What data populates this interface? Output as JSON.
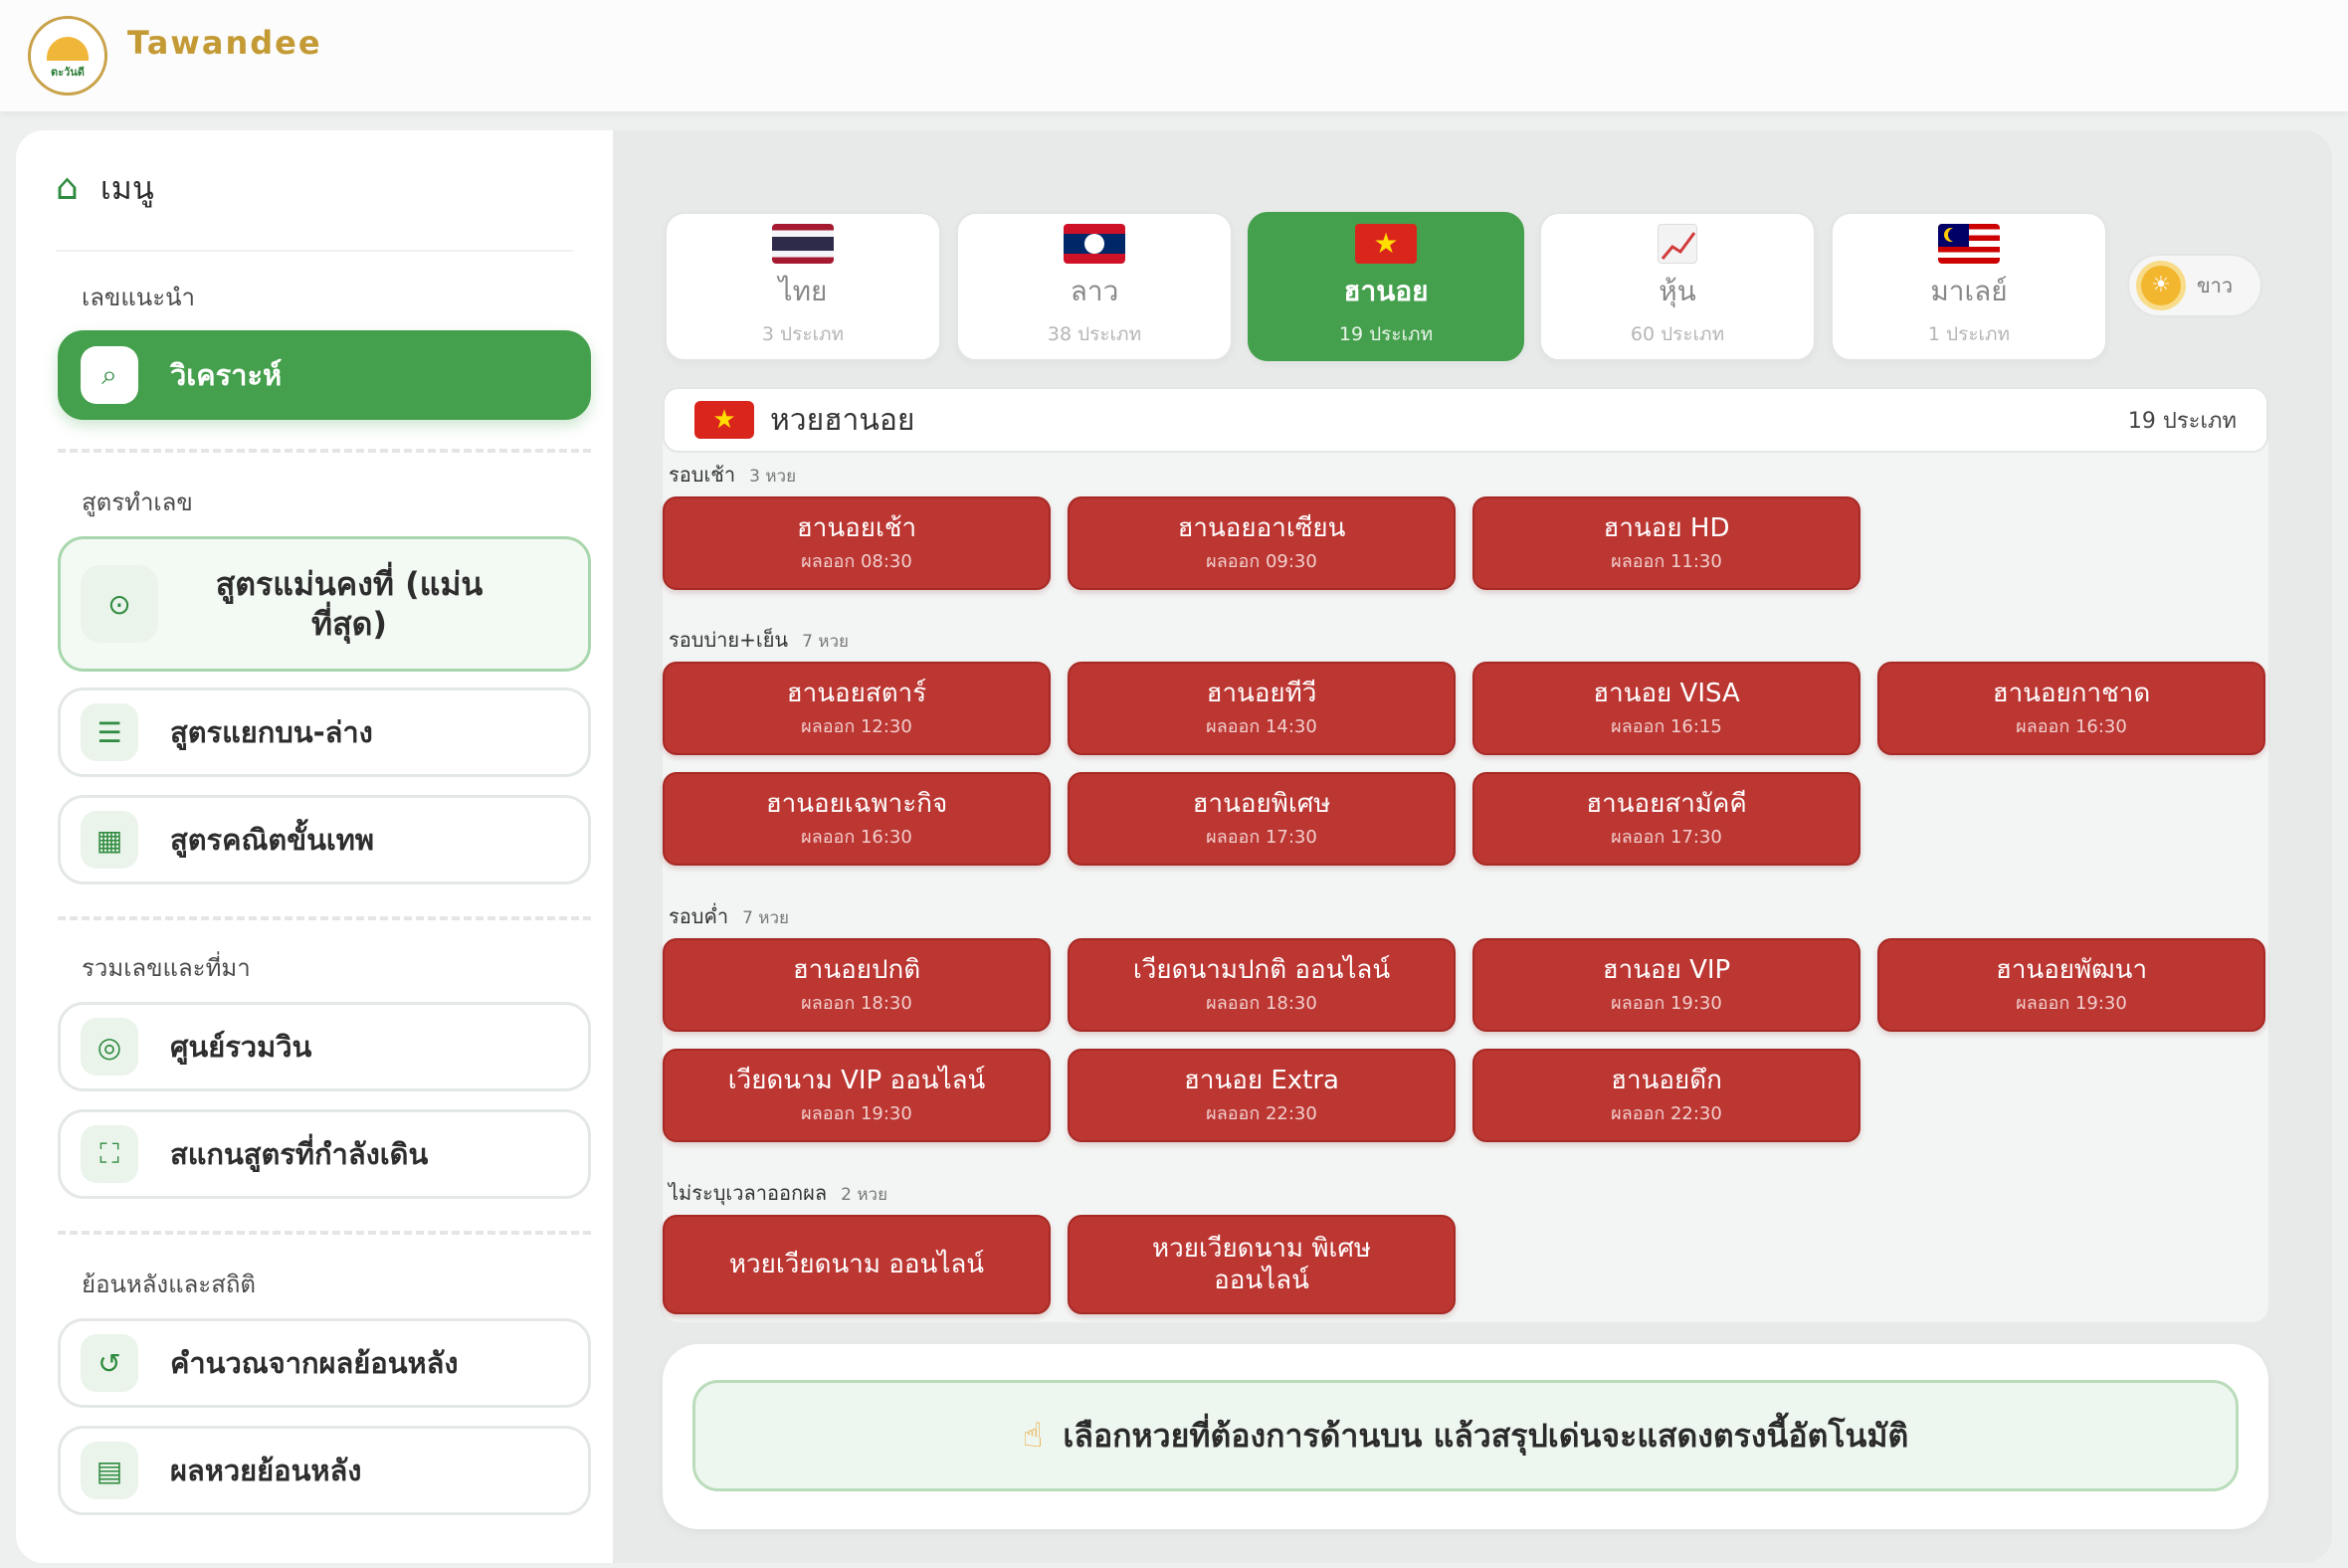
{
  "header": {
    "brand": "Tawandee",
    "logo_text": "ตะวันดี"
  },
  "sidebar": {
    "menu_title": "เมนู",
    "sections": [
      {
        "label": "เลขแนะนำ",
        "items": [
          {
            "label": "วิเคราะห์",
            "icon": "search-icon",
            "active": true
          }
        ]
      },
      {
        "label": "สูตรทำเลข",
        "items": [
          {
            "label": "สูตรแม่นคงที่ (แม่นที่สุด)",
            "icon": "target-icon",
            "highlight": true
          },
          {
            "label": "สูตรแยกบน-ล่าง",
            "icon": "rows-icon"
          },
          {
            "label": "สูตรคณิตขั้นเทพ",
            "icon": "calculator-icon"
          }
        ]
      },
      {
        "label": "รวมเลขและที่มา",
        "items": [
          {
            "label": "ศูนย์รวมวิน",
            "icon": "bullseye-icon"
          },
          {
            "label": "สแกนสูตรที่กำลังเดิน",
            "icon": "scan-icon"
          }
        ]
      },
      {
        "label": "ย้อนหลังและสถิติ",
        "items": [
          {
            "label": "คำนวณจากผลย้อนหลัง",
            "icon": "history-icon"
          },
          {
            "label": "ผลหวยย้อนหลัง",
            "icon": "calendar-icon"
          }
        ]
      }
    ]
  },
  "tabs": [
    {
      "name": "ไทย",
      "count": "3 ประเภท",
      "flag": "thai-flag-icon"
    },
    {
      "name": "ลาว",
      "count": "38 ประเภท",
      "flag": "laos-flag-icon"
    },
    {
      "name": "ฮานอย",
      "count": "19 ประเภท",
      "flag": "vietnam-flag-icon",
      "active": true
    },
    {
      "name": "หุ้น",
      "count": "60 ประเภท",
      "flag": "chart-icon"
    },
    {
      "name": "มาเลย์",
      "count": "1 ประเภท",
      "flag": "malaysia-flag-icon"
    }
  ],
  "theme_toggle": {
    "label": "ขาว",
    "icon": "sun-icon"
  },
  "panel": {
    "title": "หวยฮานอย",
    "count": "19 ประเภท",
    "groups": [
      {
        "label": "รอบเช้า",
        "count": "3 หวย",
        "items": [
          {
            "name": "ฮานอยเช้า",
            "time": "ผลออก 08:30"
          },
          {
            "name": "ฮานอยอาเซียน",
            "time": "ผลออก 09:30"
          },
          {
            "name": "ฮานอย HD",
            "time": "ผลออก 11:30"
          }
        ]
      },
      {
        "label": "รอบบ่าย+เย็น",
        "count": "7 หวย",
        "items": [
          {
            "name": "ฮานอยสตาร์",
            "time": "ผลออก 12:30"
          },
          {
            "name": "ฮานอยทีวี",
            "time": "ผลออก 14:30"
          },
          {
            "name": "ฮานอย VISA",
            "time": "ผลออก 16:15"
          },
          {
            "name": "ฮานอยกาชาด",
            "time": "ผลออก 16:30"
          },
          {
            "name": "ฮานอยเฉพาะกิจ",
            "time": "ผลออก 16:30"
          },
          {
            "name": "ฮานอยพิเศษ",
            "time": "ผลออก 17:30"
          },
          {
            "name": "ฮานอยสามัคคี",
            "time": "ผลออก 17:30"
          }
        ]
      },
      {
        "label": "รอบค่ำ",
        "count": "7 หวย",
        "items": [
          {
            "name": "ฮานอยปกติ",
            "time": "ผลออก 18:30"
          },
          {
            "name": "เวียดนามปกติ ออนไลน์",
            "time": "ผลออก 18:30"
          },
          {
            "name": "ฮานอย VIP",
            "time": "ผลออก 19:30"
          },
          {
            "name": "ฮานอยพัฒนา",
            "time": "ผลออก 19:30"
          },
          {
            "name": "เวียดนาม VIP ออนไลน์",
            "time": "ผลออก 19:30"
          },
          {
            "name": "ฮานอย Extra",
            "time": "ผลออก 22:30"
          },
          {
            "name": "ฮานอยดึก",
            "time": "ผลออก 22:30"
          }
        ]
      },
      {
        "label": "ไม่ระบุเวลาออกผล",
        "count": "2 หวย",
        "items": [
          {
            "name": "หวยเวียดนาม ออนไลน์",
            "time": ""
          },
          {
            "name": "หวยเวียดนาม พิเศษ ออนไลน์",
            "time": ""
          }
        ]
      }
    ]
  },
  "bottom": {
    "message": "เลือกหวยที่ต้องการด้านบน แล้วสรุปเด่นจะแสดงตรงนี้อัตโนมัติ",
    "icon": "pointing-hand-icon"
  },
  "colors": {
    "primary_green": "#45a04d",
    "lottery_red": "#bc3632",
    "brand_gold": "#c49a35"
  }
}
